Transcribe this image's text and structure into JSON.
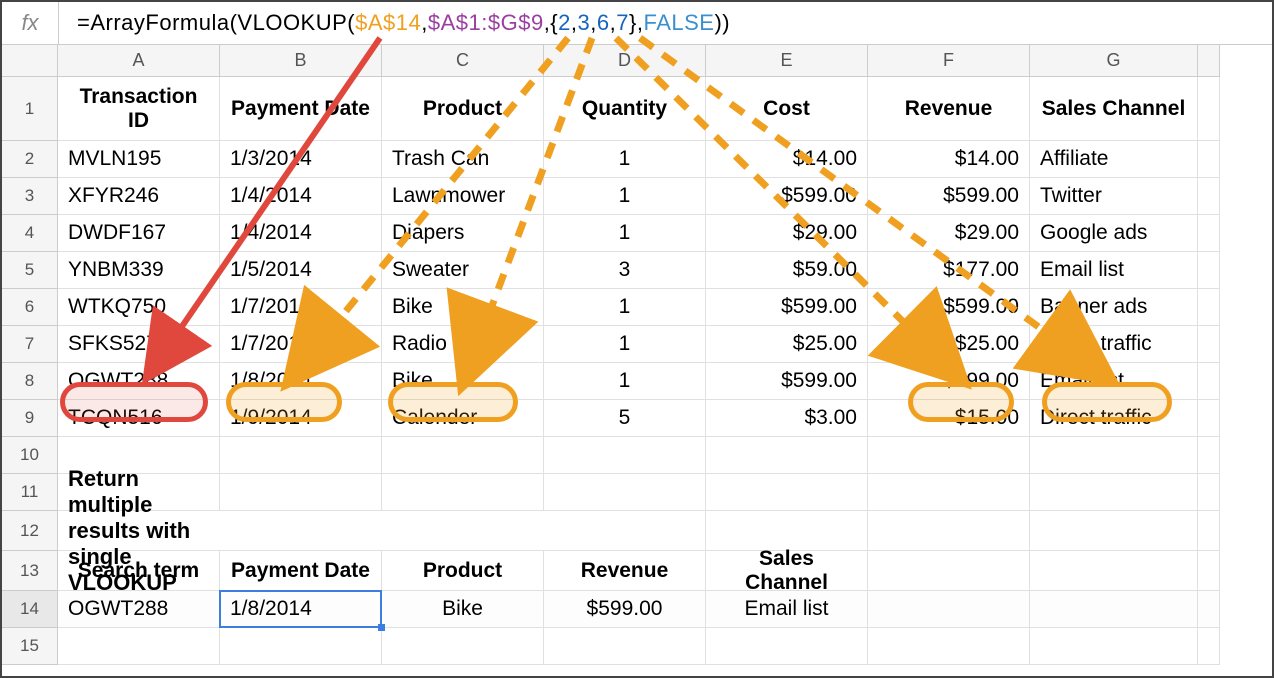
{
  "formula_bar": {
    "fx_label": "fx",
    "prefix": "=ArrayFormula(VLOOKUP(",
    "arg1": "$A$14",
    "sep1": ",",
    "arg2": "$A$1:$G$9",
    "sep2": ",{",
    "n1": "2",
    "s1": ",",
    "n2": "3",
    "s2": ",",
    "n3": "6",
    "s3": ",",
    "n4": "7",
    "sep3": "},",
    "arg4": "FALSE",
    "suffix": "))"
  },
  "columns": [
    "A",
    "B",
    "C",
    "D",
    "E",
    "F",
    "G",
    ""
  ],
  "rows": [
    "1",
    "2",
    "3",
    "4",
    "5",
    "6",
    "7",
    "8",
    "9",
    "10",
    "11",
    "12",
    "13",
    "14",
    "15"
  ],
  "headers": {
    "A": "Transaction ID",
    "B": "Payment Date",
    "C": "Product",
    "D": "Quantity",
    "E": "Cost",
    "F": "Revenue",
    "G": "Sales Channel"
  },
  "data": [
    {
      "A": "MVLN195",
      "B": "1/3/2014",
      "C": "Trash Can",
      "D": "1",
      "E": "$14.00",
      "F": "$14.00",
      "G": "Affiliate"
    },
    {
      "A": "XFYR246",
      "B": "1/4/2014",
      "C": "Lawnmower",
      "D": "1",
      "E": "$599.00",
      "F": "$599.00",
      "G": "Twitter"
    },
    {
      "A": "DWDF167",
      "B": "1/4/2014",
      "C": "Diapers",
      "D": "1",
      "E": "$29.00",
      "F": "$29.00",
      "G": "Google ads"
    },
    {
      "A": "YNBM339",
      "B": "1/5/2014",
      "C": "Sweater",
      "D": "3",
      "E": "$59.00",
      "F": "$177.00",
      "G": "Email list"
    },
    {
      "A": "WTKQ750",
      "B": "1/7/2014",
      "C": "Bike",
      "D": "1",
      "E": "$599.00",
      "F": "$599.00",
      "G": "Banner ads"
    },
    {
      "A": "SFKS527",
      "B": "1/7/2014",
      "C": "Radio",
      "D": "1",
      "E": "$25.00",
      "F": "$25.00",
      "G": "Direct traffic"
    },
    {
      "A": "OGWT288",
      "B": "1/8/2014",
      "C": "Bike",
      "D": "1",
      "E": "$599.00",
      "F": "$599.00",
      "G": "Email list"
    },
    {
      "A": "TCQN516",
      "B": "1/9/2014",
      "C": "Calender",
      "D": "5",
      "E": "$3.00",
      "F": "$15.00",
      "G": "Direct traffic"
    }
  ],
  "section_title": "Return multiple results with single VLOOKUP",
  "search_headers": {
    "A": "Search term",
    "B": "Payment Date",
    "C": "Product",
    "D": "Revenue",
    "E": "Sales Channel"
  },
  "search_row": {
    "A": "OGWT288",
    "B": "1/8/2014",
    "C": "Bike",
    "D": "$599.00",
    "E": "Email list"
  }
}
